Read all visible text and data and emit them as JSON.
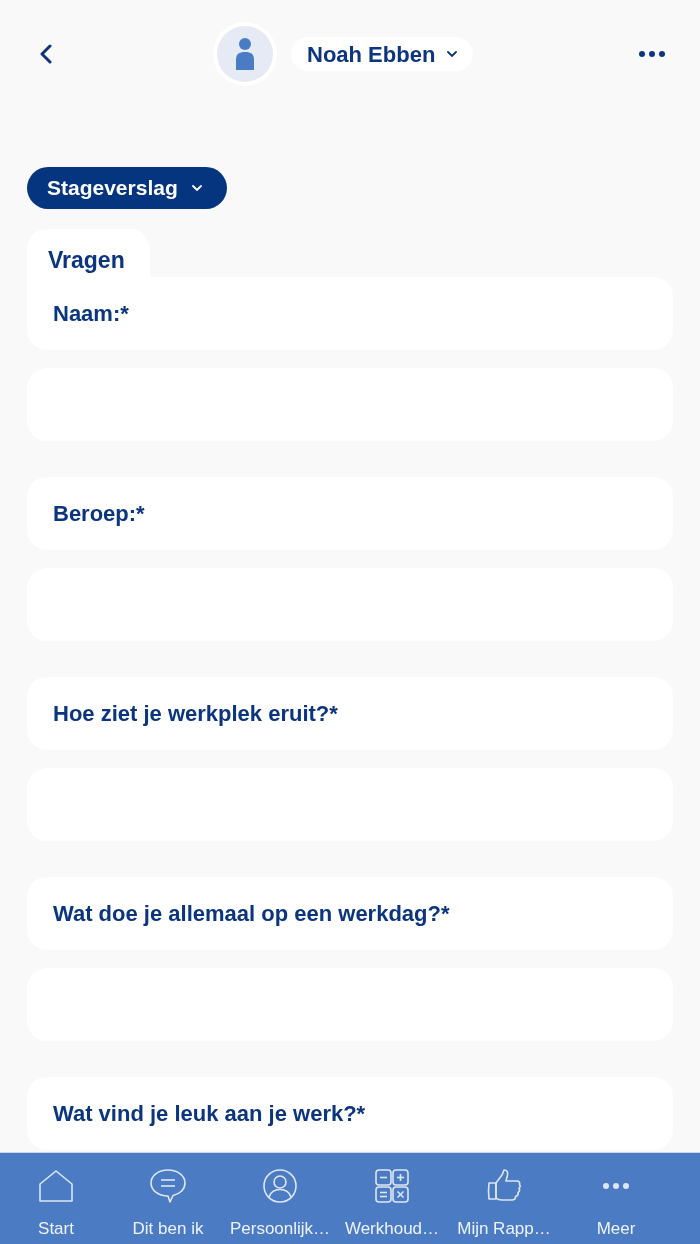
{
  "header": {
    "name": "Noah Ebben"
  },
  "form_selector": {
    "label": "Stageverslag"
  },
  "tab": {
    "label": "Vragen"
  },
  "form_items": [
    {
      "kind": "question",
      "label": "Naam:*"
    },
    {
      "kind": "answer"
    },
    {
      "kind": "question",
      "label": "Beroep:*"
    },
    {
      "kind": "answer"
    },
    {
      "kind": "question",
      "label": "Hoe ziet je werkplek eruit?*"
    },
    {
      "kind": "answer"
    },
    {
      "kind": "question",
      "label": "Wat doe je allemaal op een werkdag?*"
    },
    {
      "kind": "answer"
    },
    {
      "kind": "question",
      "label": "Wat vind je leuk aan je werk?*"
    }
  ],
  "bottom_nav": [
    {
      "kind": "home",
      "label": "Start"
    },
    {
      "kind": "chat",
      "label": "Dit ben ik"
    },
    {
      "kind": "profile",
      "label": "Persoonlijk…"
    },
    {
      "kind": "calculator",
      "label": "Werkhoud…"
    },
    {
      "kind": "thumbs",
      "label": "Mijn Rapp…"
    },
    {
      "kind": "more",
      "label": "Meer"
    }
  ]
}
